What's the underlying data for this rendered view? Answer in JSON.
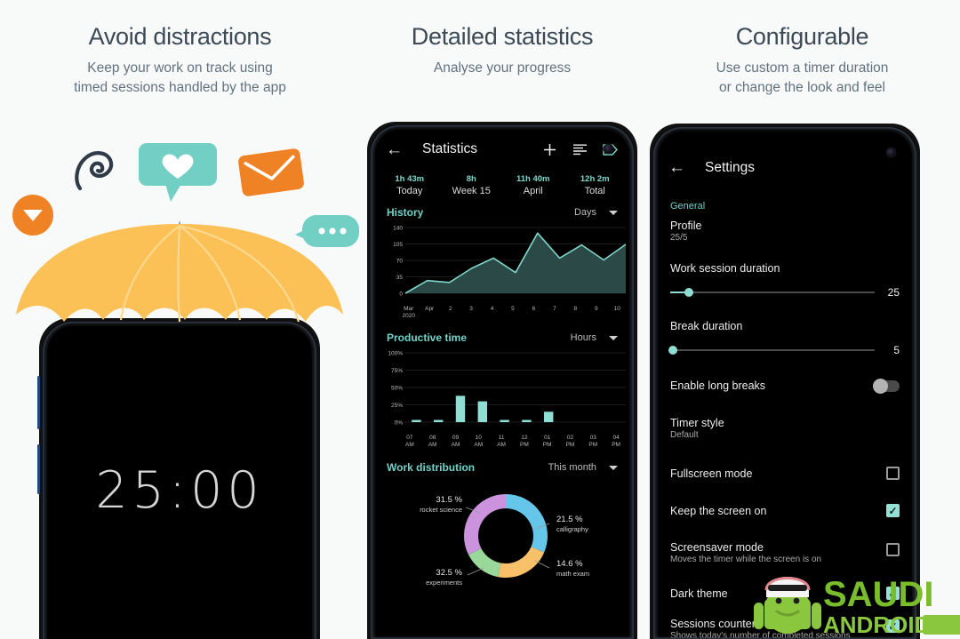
{
  "panels": [
    {
      "title": "Avoid distractions",
      "subtitle_line1": "Keep your work on track using",
      "subtitle_line2": "timed sessions handled by the app"
    },
    {
      "title": "Detailed statistics",
      "subtitle_line1": "Analyse your progress",
      "subtitle_line2": ""
    },
    {
      "title": "Configurable",
      "subtitle_line1": "Use custom a timer duration",
      "subtitle_line2": "or change the look and feel"
    }
  ],
  "timer_screen": {
    "time": "25:00",
    "icons": [
      "play-circle-icon",
      "paperclip-icon",
      "chat-heart-icon",
      "mail-icon",
      "chat-dots-icon",
      "umbrella-icon"
    ]
  },
  "stats_screen": {
    "appbar": {
      "back": "←",
      "title": "Statistics",
      "add_label": "+",
      "sort_label": "sort-icon",
      "tag_label": "tag-icon"
    },
    "summary": [
      {
        "value": "1h 43m",
        "label": "Today"
      },
      {
        "value": "8h",
        "label": "Week 15"
      },
      {
        "value": "11h 40m",
        "label": "April"
      },
      {
        "value": "12h 2m",
        "label": "Total"
      }
    ],
    "history": {
      "title": "History",
      "selector": "Days"
    },
    "productive": {
      "title": "Productive time",
      "selector": "Hours"
    },
    "distribution": {
      "title": "Work distribution",
      "selector": "This month"
    }
  },
  "settings_screen": {
    "appbar": {
      "back": "←",
      "title": "Settings"
    },
    "category": "General",
    "rows": [
      {
        "title": "Profile",
        "subtitle": "25/5",
        "control": "none"
      },
      {
        "title": "Work session duration",
        "subtitle": "",
        "control": "slider",
        "value": "25",
        "fill_pct": 9
      },
      {
        "title": "Break duration",
        "subtitle": "",
        "control": "slider",
        "value": "5",
        "fill_pct": 0
      },
      {
        "title": "Enable long breaks",
        "subtitle": "",
        "control": "toggle",
        "value": "off"
      },
      {
        "title": "Timer style",
        "subtitle": "Default",
        "control": "none"
      },
      {
        "title": "Fullscreen mode",
        "subtitle": "",
        "control": "checkbox",
        "value": "off"
      },
      {
        "title": "Keep the screen on",
        "subtitle": "",
        "control": "checkbox",
        "value": "on"
      },
      {
        "title": "Screensaver mode",
        "subtitle": "Moves the timer while the screen is on",
        "control": "checkbox",
        "value": "off"
      },
      {
        "title": "Dark theme",
        "subtitle": "",
        "control": "checkbox",
        "value": "on"
      },
      {
        "title": "Sessions counter",
        "subtitle": "Shows today's number of completed sessions",
        "control": "checkbox",
        "value": "on"
      }
    ]
  },
  "watermark": {
    "line1": "SAUDI",
    "line2": "ANDROID"
  },
  "colors": {
    "accent_teal": "#7fd6cc",
    "orange": "#f08226",
    "umbrella_yellow": "#fbc156",
    "bubble_teal": "#72cfc4",
    "heading": "#3c4a56",
    "subheading": "#62727f",
    "page_bg": "#f8f9f9"
  },
  "chart_data": [
    {
      "type": "area",
      "title": "History",
      "xlabel": "",
      "ylabel": "",
      "categories": [
        "Mar 2020",
        "Apr",
        "2",
        "3",
        "4",
        "5",
        "6",
        "7",
        "8",
        "9",
        "10"
      ],
      "values": [
        0,
        27,
        23,
        53,
        75,
        44,
        128,
        75,
        103,
        71,
        104
      ],
      "yticks": [
        0,
        35,
        70,
        105,
        140
      ],
      "ylim": [
        0,
        140
      ],
      "grid": true,
      "legend": "none",
      "selector": "Days"
    },
    {
      "type": "bar",
      "title": "Productive time",
      "xlabel": "",
      "ylabel": "",
      "categories": [
        "07 AM",
        "08 AM",
        "09 AM",
        "10 AM",
        "11 AM",
        "12 PM",
        "01 PM",
        "02 PM",
        "03 PM",
        "04 PM"
      ],
      "values": [
        3,
        3,
        38,
        30,
        2,
        2,
        15,
        0,
        0,
        0
      ],
      "yticks": [
        "0%",
        "25%",
        "50%",
        "75%",
        "100%"
      ],
      "ylim": [
        0,
        100
      ],
      "grid": true,
      "legend": "none",
      "selector": "Hours"
    },
    {
      "type": "pie",
      "title": "Work distribution",
      "labels": [
        "rocket science",
        "calligraphy",
        "math exam",
        "experiments"
      ],
      "values": [
        31.5,
        21.5,
        14.6,
        32.5
      ],
      "value_labels": [
        "31.5 %",
        "21.5 %",
        "14.6 %",
        "32.5 %"
      ],
      "colors": [
        "#66c6ea",
        "#f9c06a",
        "#99d89a",
        "#cb93dd"
      ],
      "legend": "callouts",
      "selector": "This month"
    }
  ]
}
